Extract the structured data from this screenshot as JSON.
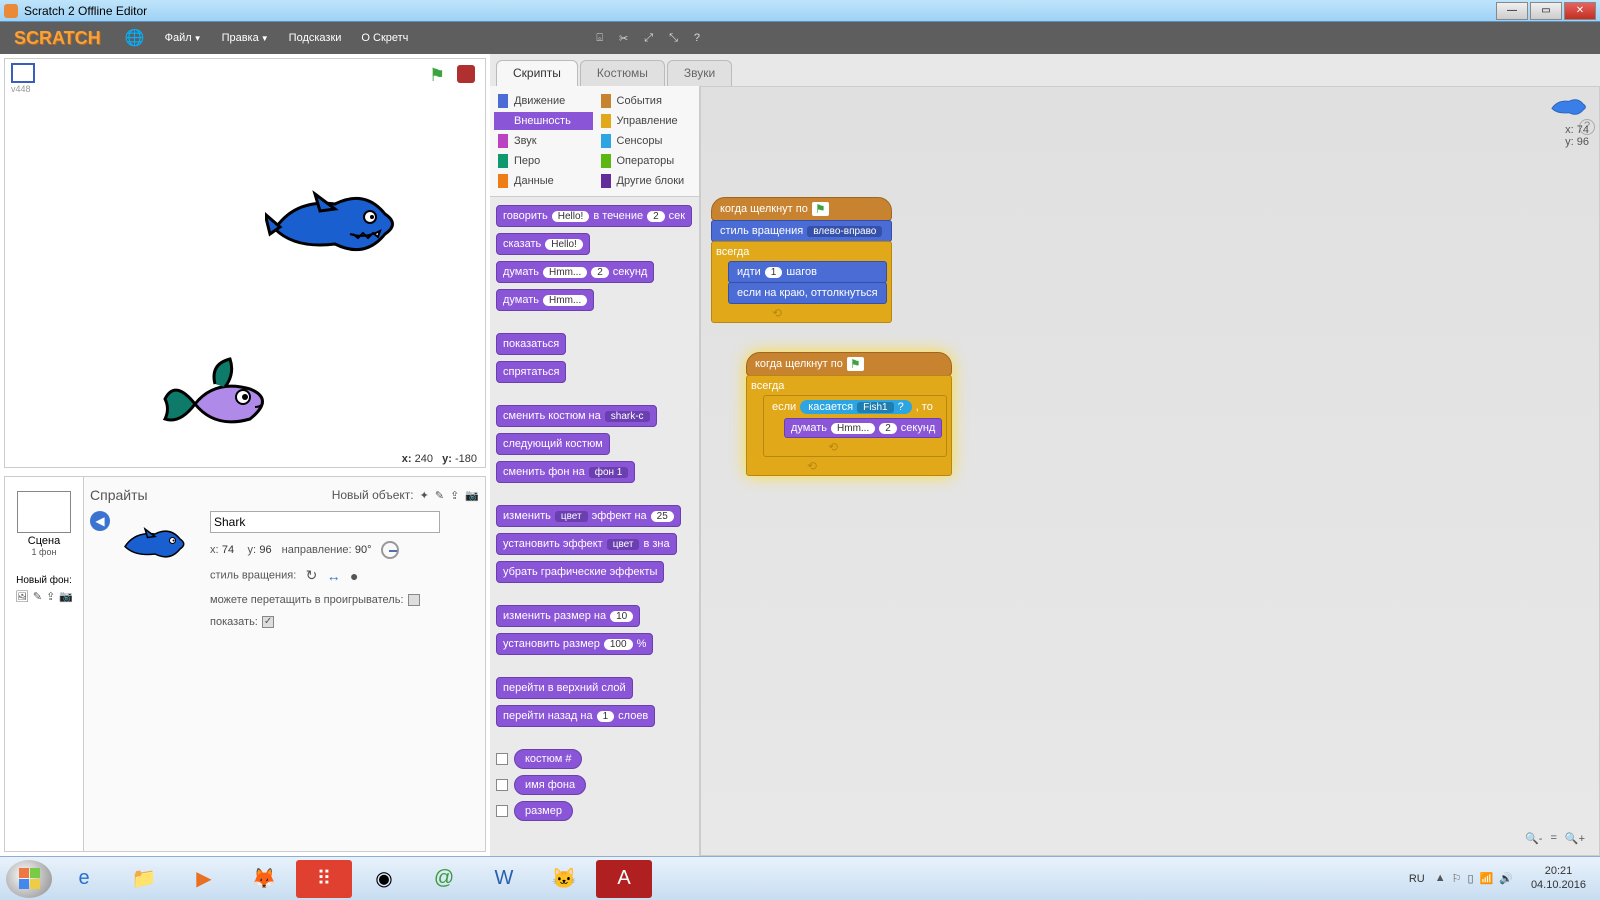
{
  "window": {
    "title": "Scratch 2 Offline Editor"
  },
  "menu": {
    "logo": "SCRATCH",
    "file": "Файл",
    "edit": "Правка",
    "tips": "Подсказки",
    "about": "О Скретч"
  },
  "stage": {
    "version": "v448",
    "coords_x_label": "x:",
    "coords_x": "240",
    "coords_y_label": "y:",
    "coords_y": "-180"
  },
  "scene": {
    "label": "Сцена",
    "sublabel": "1 фон",
    "newbg": "Новый фон:"
  },
  "sprites": {
    "title": "Спрайты",
    "newobj": "Новый объект:",
    "name": "Shark",
    "x_label": "x:",
    "x": "74",
    "y_label": "y:",
    "y": "96",
    "dir_label": "направление:",
    "dir": "90°",
    "rotstyle_label": "стиль вращения:",
    "drag_label": "можете перетащить в проигрыватель:",
    "show_label": "показать:"
  },
  "tabs": {
    "scripts": "Скрипты",
    "costumes": "Костюмы",
    "sounds": "Звуки"
  },
  "categories": {
    "motion": "Движение",
    "looks": "Внешность",
    "sound": "Звук",
    "pen": "Перо",
    "data": "Данные",
    "events": "События",
    "control": "Управление",
    "sensing": "Сенсоры",
    "operators": "Операторы",
    "more": "Другие блоки"
  },
  "cat_colors": {
    "motion": "#4a6cd4",
    "looks": "#8a55d7",
    "sound": "#bb42c3",
    "pen": "#0e9a6c",
    "data": "#ee7d16",
    "events": "#c88330",
    "control": "#e1a91a",
    "sensing": "#2ca5e2",
    "operators": "#5cb712",
    "more": "#632d99"
  },
  "blocks": {
    "say_for": "говорить",
    "hello": "Hello!",
    "for_sec": "в течение",
    "two": "2",
    "sec_suffix": "сек",
    "say": "сказать",
    "think_for": "думать",
    "hmm": "Hmm...",
    "seconds": "секунд",
    "think": "думать",
    "show": "показаться",
    "hide": "спрятаться",
    "switch_costume": "сменить костюм на",
    "costume_val": "shark-c",
    "next_costume": "следующий костюм",
    "switch_bg": "сменить фон на",
    "bg_val": "фон 1",
    "change_effect": "изменить",
    "color_word": "цвет",
    "effect_by": "эффект на",
    "n25": "25",
    "set_effect": "установить эффект",
    "to_val": "в зна",
    "clear_effects": "убрать графические эффекты",
    "change_size": "изменить размер на",
    "n10": "10",
    "set_size": "установить размер",
    "n100": "100",
    "pct": "%",
    "go_front": "перейти в верхний слой",
    "go_back": "перейти назад на",
    "n1": "1",
    "layers": "слоев",
    "costume_num": "костюм #",
    "bg_name": "имя фона",
    "size": "размер"
  },
  "scripts": {
    "when_flag": "когда щелкнут по",
    "rot_style": "стиль вращения",
    "rot_val": "влево-вправо",
    "forever": "всегда",
    "move": "идти",
    "steps": "шагов",
    "bounce": "если на краю, оттолкнуться",
    "if": "если",
    "then": ", то",
    "touching": "касается",
    "fish_sprite": "Fish1",
    "qmark": "?",
    "think": "думать",
    "hmm": "Hmm...",
    "two": "2",
    "sec": "секунд"
  },
  "canvas": {
    "x_label": "x:",
    "x": "74",
    "y_label": "y:",
    "y": "96"
  },
  "taskbar": {
    "lang": "RU",
    "time": "20:21",
    "date": "04.10.2016"
  }
}
